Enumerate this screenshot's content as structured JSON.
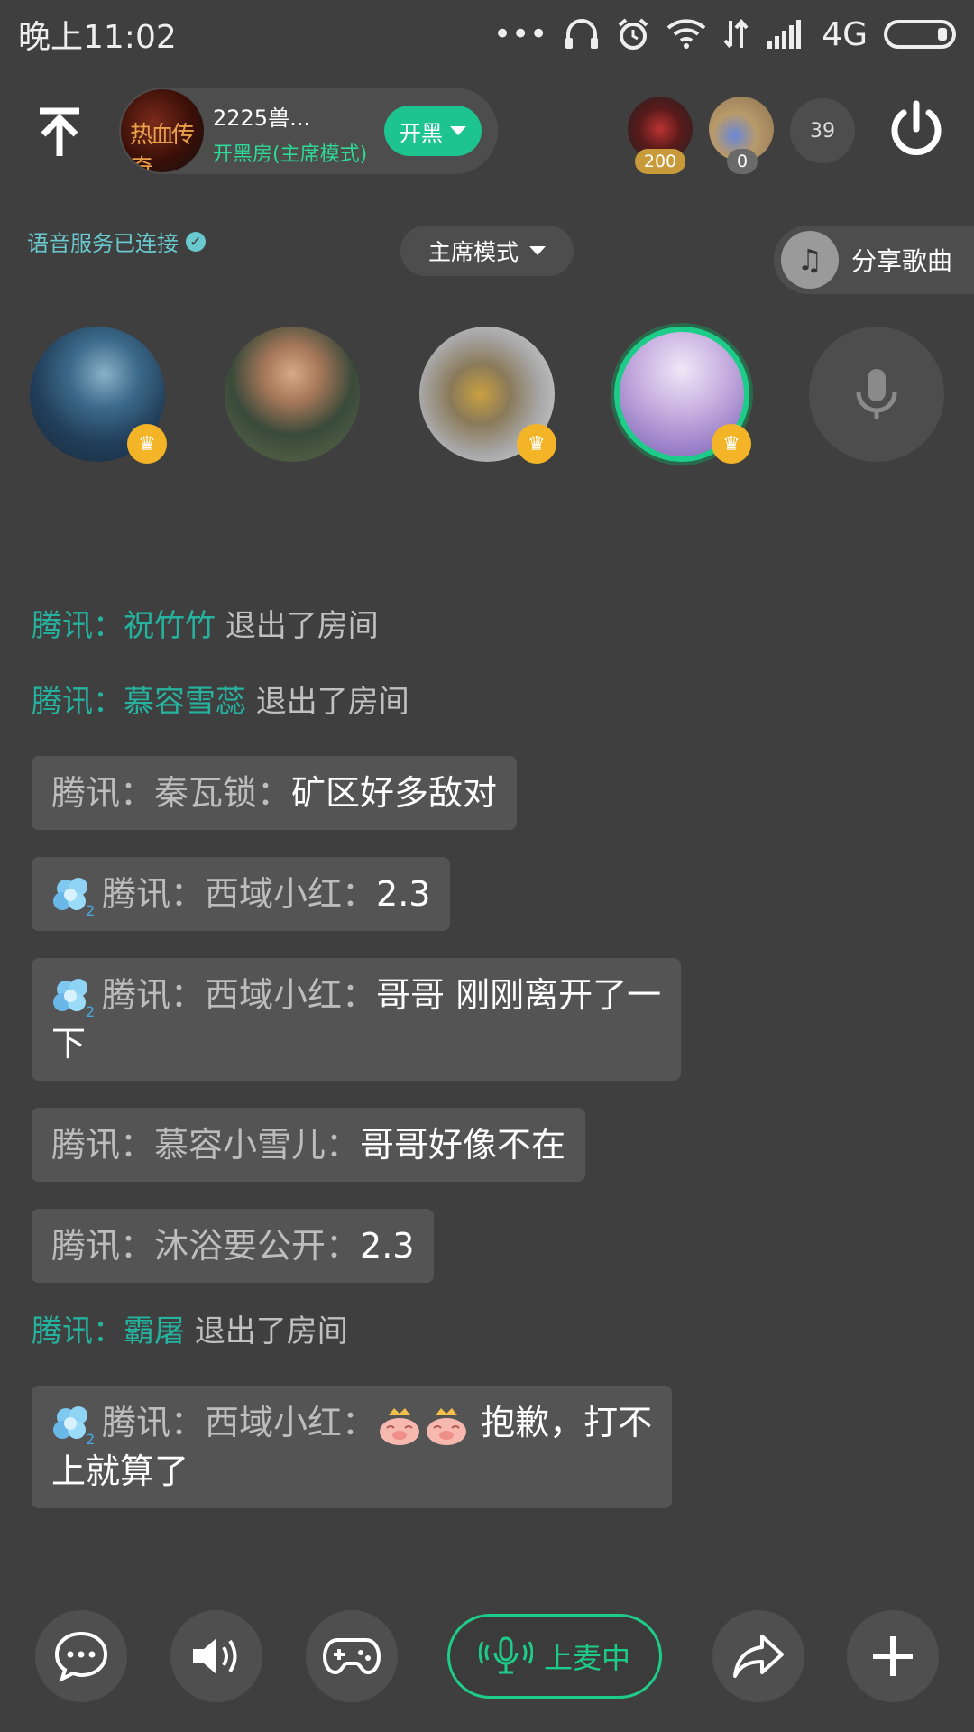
{
  "status_bar": {
    "time": "晚上11:02",
    "network": "4G"
  },
  "header": {
    "room_name": "2225兽...",
    "room_mode": "开黑房(主席模式)",
    "kaihei_label": "开黑",
    "audience_badge_1": "200",
    "audience_badge_2": "0",
    "audience_count": "39"
  },
  "room": {
    "voice_status": "语音服务已连接",
    "mode_select": "主席模式",
    "share_song": "分享歌曲"
  },
  "chat": {
    "sys1": {
      "prefix": "腾讯：",
      "name": "祝竹竹",
      "action": " 退出了房间"
    },
    "sys2": {
      "prefix": "腾讯：",
      "name": "慕容雪蕊",
      "action": " 退出了房间"
    },
    "msg1": {
      "name": "腾讯：秦瓦锁：",
      "text": "矿区好多敌对"
    },
    "msg2": {
      "name": "腾讯：西域小红：",
      "text": "2.3"
    },
    "msg3": {
      "name": "腾讯：西域小红：",
      "text": "哥哥 刚刚离开了一",
      "text2": "下"
    },
    "msg4": {
      "name": "腾讯：慕容小雪儿：",
      "text": "哥哥好像不在"
    },
    "msg5": {
      "name": "腾讯：沐浴要公开：",
      "text": "2.3"
    },
    "sys3": {
      "prefix": "腾讯：",
      "name": "霸屠",
      "action": " 退出了房间"
    },
    "msg6": {
      "name": "腾讯：西域小红：",
      "text": " 抱歉，打不",
      "text2": "上就算了"
    }
  },
  "toolbar": {
    "mic_status": "上麦中"
  },
  "colors": {
    "accent": "#1ecc8a",
    "name_teal": "#25b3a0",
    "background": "#3f3f3f",
    "crown": "#f3b427"
  }
}
